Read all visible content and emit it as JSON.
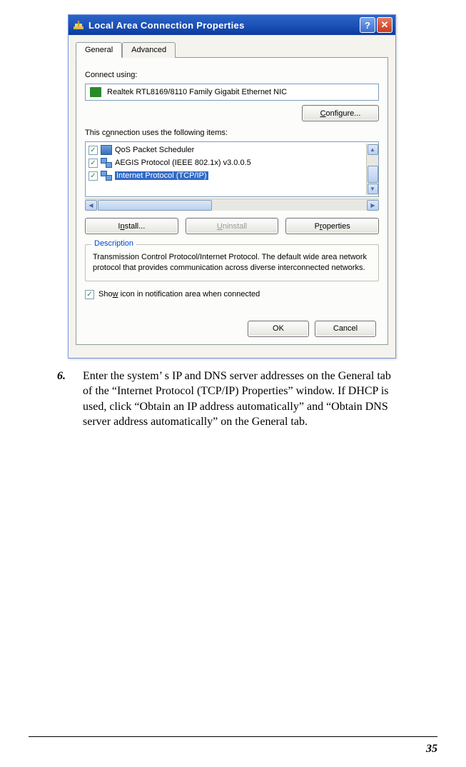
{
  "dialog": {
    "title": "Local Area Connection Properties",
    "tabs": {
      "general": "General",
      "advanced": "Advanced"
    },
    "connect_using_label": "Connect using:",
    "adapter_name": "Realtek RTL8169/8110 Family Gigabit Ethernet NIC",
    "configure_button": "Configure...",
    "items_label": "This connection uses the following items:",
    "items": [
      {
        "checked": true,
        "label": "QoS Packet Scheduler"
      },
      {
        "checked": true,
        "label": "AEGIS Protocol (IEEE 802.1x) v3.0.0.5"
      },
      {
        "checked": true,
        "label": "Internet Protocol (TCP/IP)",
        "selected": true
      }
    ],
    "install_button": "Install...",
    "uninstall_button": "Uninstall",
    "properties_button": "Properties",
    "description_legend": "Description",
    "description_text": "Transmission Control Protocol/Internet Protocol. The default wide area network protocol that provides communication across diverse interconnected networks.",
    "show_icon_checked": true,
    "show_icon_label": "Show icon in notification area when connected",
    "ok_button": "OK",
    "cancel_button": "Cancel"
  },
  "instruction": {
    "number": "6.",
    "text": "Enter the system’ s IP and DNS server addresses on the General tab of the “Internet Protocol (TCP/IP) Properties” window.  If DHCP is used, click “Obtain an IP address automatically” and “Obtain DNS server address automatically” on the General tab."
  },
  "page_number": "35"
}
